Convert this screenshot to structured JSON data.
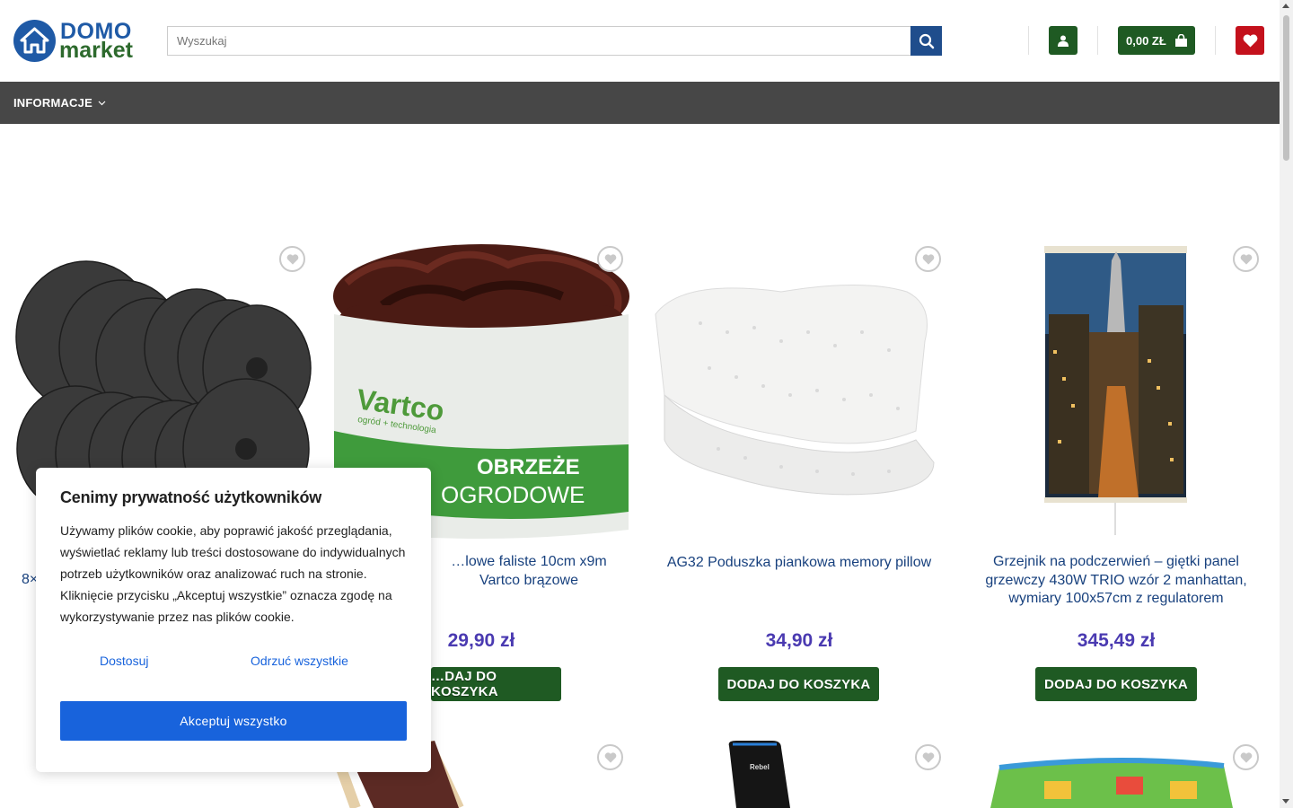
{
  "logo": {
    "line1": "DOMO",
    "line2": "market"
  },
  "search": {
    "placeholder": "Wyszukaj"
  },
  "cart": {
    "total": "0,00 ZŁ"
  },
  "nav": {
    "items": [
      {
        "label": "INFORMACJE"
      }
    ]
  },
  "products": [
    {
      "title": "8×",
      "price": "",
      "button": ""
    },
    {
      "title": "…lowe faliste 10cm x9m Vartco brązowe",
      "price": "29,90 zł",
      "button": "…DAJ DO KOSZYKA",
      "image_text": {
        "brand": "Vartco",
        "tagline": "ogród + technologia",
        "label1": "OBRZEŻE",
        "label2": "OGRODOWE"
      }
    },
    {
      "title": "AG32 Poduszka piankowa memory pillow",
      "price": "34,90 zł",
      "button": "DODAJ DO KOSZYKA"
    },
    {
      "title": "Grzejnik na podczerwień – giętki panel grzewczy 430W TRIO wzór 2 manhattan, wymiary 100x57cm z regulatorem",
      "price": "345,49 zł",
      "button": "DODAJ DO KOSZYKA"
    }
  ],
  "row2_image_text": {
    "brand": "Rebel"
  },
  "cookie": {
    "title": "Cenimy prywatność użytkowników",
    "body": "Używamy plików cookie, aby poprawić jakość przeglądania, wyświetlać reklamy lub treści dostosowane do indywidualnych potrzeb użytkowników oraz analizować ruch na stronie. Kliknięcie przycisku „Akceptuj wszystkie” oznacza zgodę na wykorzystywanie przez nas plików cookie.",
    "customize": "Dostosuj",
    "reject": "Odrzuć wszystkie",
    "accept": "Akceptuj wszystko"
  },
  "colors": {
    "brand_blue": "#1f5aa6",
    "brand_green": "#1f5a23",
    "price": "#4a3ab1",
    "wishlist_red": "#c4111c",
    "nav_bg": "#474747",
    "cookie_blue": "#1863dc"
  }
}
